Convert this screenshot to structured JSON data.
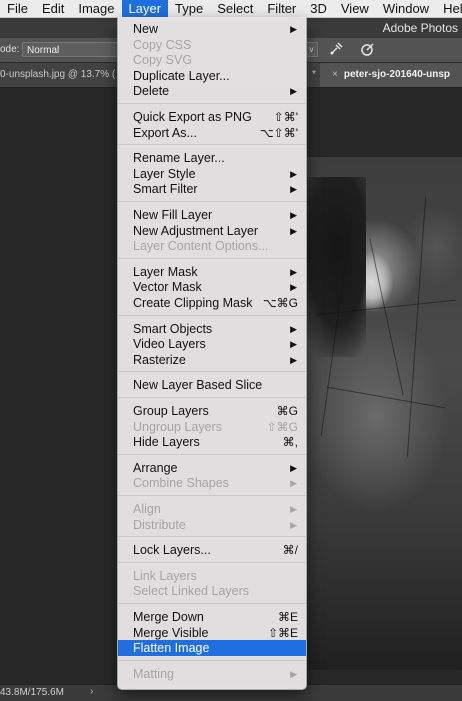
{
  "menubar": {
    "items": [
      "File",
      "Edit",
      "Image",
      "Layer",
      "Type",
      "Select",
      "Filter",
      "3D",
      "View",
      "Window",
      "Help"
    ],
    "active_index": 3
  },
  "app_title": "Adobe Photos",
  "options_bar": {
    "mode_label": "ode:",
    "mode_value": "Normal",
    "dropdown_indicator": "v"
  },
  "tabs": {
    "left_tab": "0-unsplash.jpg @ 13.7% (",
    "middle_tab": "*",
    "right_tab_close": "×",
    "right_tab": "peter-sjo-201640-unsp"
  },
  "status_bar": {
    "doc_size": "43.8M/175.6M",
    "arrow": "›"
  },
  "layer_menu": {
    "groups": [
      [
        {
          "label": "New",
          "shortcut": "",
          "submenu": true,
          "enabled": true
        },
        {
          "label": "Copy CSS",
          "shortcut": "",
          "submenu": false,
          "enabled": false
        },
        {
          "label": "Copy SVG",
          "shortcut": "",
          "submenu": false,
          "enabled": false
        },
        {
          "label": "Duplicate Layer...",
          "shortcut": "",
          "submenu": false,
          "enabled": true
        },
        {
          "label": "Delete",
          "shortcut": "",
          "submenu": true,
          "enabled": true
        }
      ],
      [
        {
          "label": "Quick Export as PNG",
          "shortcut": "⇧⌘'",
          "submenu": false,
          "enabled": true
        },
        {
          "label": "Export As...",
          "shortcut": "⌥⇧⌘'",
          "submenu": false,
          "enabled": true
        }
      ],
      [
        {
          "label": "Rename Layer...",
          "shortcut": "",
          "submenu": false,
          "enabled": true
        },
        {
          "label": "Layer Style",
          "shortcut": "",
          "submenu": true,
          "enabled": true
        },
        {
          "label": "Smart Filter",
          "shortcut": "",
          "submenu": true,
          "enabled": true
        }
      ],
      [
        {
          "label": "New Fill Layer",
          "shortcut": "",
          "submenu": true,
          "enabled": true
        },
        {
          "label": "New Adjustment Layer",
          "shortcut": "",
          "submenu": true,
          "enabled": true
        },
        {
          "label": "Layer Content Options...",
          "shortcut": "",
          "submenu": false,
          "enabled": false
        }
      ],
      [
        {
          "label": "Layer Mask",
          "shortcut": "",
          "submenu": true,
          "enabled": true
        },
        {
          "label": "Vector Mask",
          "shortcut": "",
          "submenu": true,
          "enabled": true
        },
        {
          "label": "Create Clipping Mask",
          "shortcut": "⌥⌘G",
          "submenu": false,
          "enabled": true
        }
      ],
      [
        {
          "label": "Smart Objects",
          "shortcut": "",
          "submenu": true,
          "enabled": true
        },
        {
          "label": "Video Layers",
          "shortcut": "",
          "submenu": true,
          "enabled": true
        },
        {
          "label": "Rasterize",
          "shortcut": "",
          "submenu": true,
          "enabled": true
        }
      ],
      [
        {
          "label": "New Layer Based Slice",
          "shortcut": "",
          "submenu": false,
          "enabled": true
        }
      ],
      [
        {
          "label": "Group Layers",
          "shortcut": "⌘G",
          "submenu": false,
          "enabled": true
        },
        {
          "label": "Ungroup Layers",
          "shortcut": "⇧⌘G",
          "submenu": false,
          "enabled": false
        },
        {
          "label": "Hide Layers",
          "shortcut": "⌘,",
          "submenu": false,
          "enabled": true
        }
      ],
      [
        {
          "label": "Arrange",
          "shortcut": "",
          "submenu": true,
          "enabled": true
        },
        {
          "label": "Combine Shapes",
          "shortcut": "",
          "submenu": true,
          "enabled": false
        }
      ],
      [
        {
          "label": "Align",
          "shortcut": "",
          "submenu": true,
          "enabled": false
        },
        {
          "label": "Distribute",
          "shortcut": "",
          "submenu": true,
          "enabled": false
        }
      ],
      [
        {
          "label": "Lock Layers...",
          "shortcut": "⌘/",
          "submenu": false,
          "enabled": true
        }
      ],
      [
        {
          "label": "Link Layers",
          "shortcut": "",
          "submenu": false,
          "enabled": false
        },
        {
          "label": "Select Linked Layers",
          "shortcut": "",
          "submenu": false,
          "enabled": false
        }
      ],
      [
        {
          "label": "Merge Down",
          "shortcut": "⌘E",
          "submenu": false,
          "enabled": true
        },
        {
          "label": "Merge Visible",
          "shortcut": "⇧⌘E",
          "submenu": false,
          "enabled": true
        },
        {
          "label": "Flatten Image",
          "shortcut": "",
          "submenu": false,
          "enabled": true,
          "highlighted": true
        }
      ],
      [
        {
          "label": "Matting",
          "shortcut": "",
          "submenu": true,
          "enabled": false
        }
      ]
    ]
  },
  "colors": {
    "highlight": "#1f6fe0",
    "disabled_text": "#a5a5a5"
  }
}
